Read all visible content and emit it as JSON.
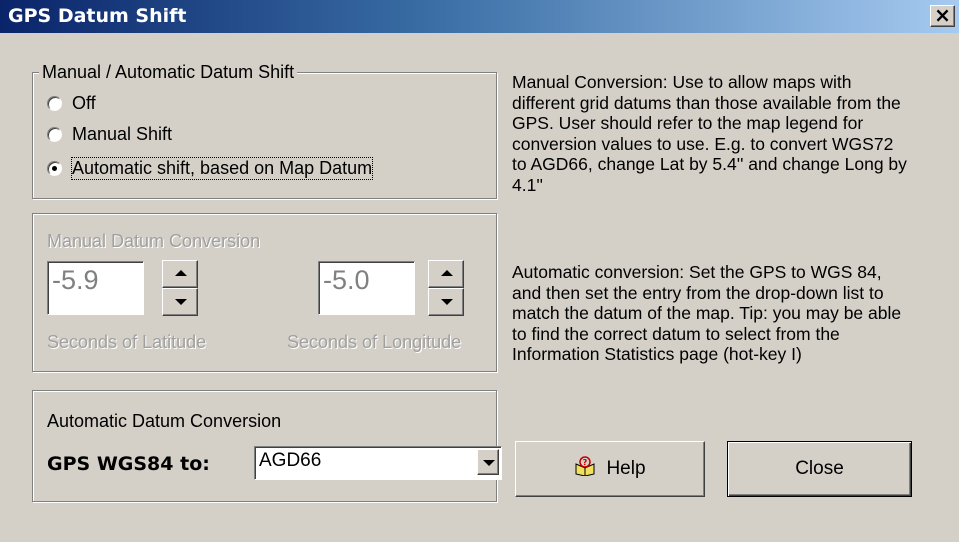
{
  "window": {
    "title": "GPS Datum Shift",
    "close_label": "×"
  },
  "shift_group": {
    "legend": "Manual / Automatic Datum Shift",
    "options": [
      {
        "label": "Off",
        "checked": false
      },
      {
        "label": "Manual Shift",
        "checked": false
      },
      {
        "label": "Automatic shift, based on Map Datum",
        "checked": true
      }
    ]
  },
  "manual_group": {
    "legend": "Manual Datum Conversion",
    "latitude_value": "-5.9",
    "latitude_label": "Seconds of Latitude",
    "longitude_value": "-5.0",
    "longitude_label": "Seconds of Longitude"
  },
  "auto_group": {
    "legend": "Automatic Datum Conversion",
    "label": "GPS WGS84 to:",
    "selected": "AGD66"
  },
  "help_text": {
    "manual": "Manual Conversion: Use to allow maps with different grid datums than those available from the GPS. User should refer to the map legend for conversion values to use.    E.g. to convert WGS72 to AGD66, change Lat by 5.4'' and change Long by 4.1''",
    "automatic": "Automatic conversion: Set the GPS to WGS 84, and then set the entry from the drop-down list to match the datum of the map. Tip: you may be able to find the correct datum to select from the Information Statistics page (hot-key I)"
  },
  "buttons": {
    "help": "Help",
    "close": "Close"
  },
  "colors": {
    "title_start": "#0a246a",
    "title_end": "#a6caf0",
    "face": "#d4d0c8",
    "disabled": "#a0a0a0"
  }
}
